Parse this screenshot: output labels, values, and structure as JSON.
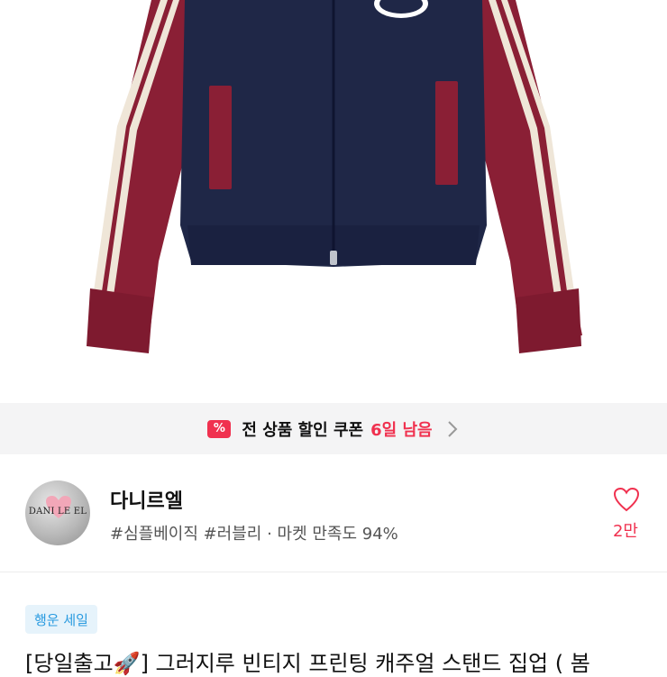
{
  "coupon": {
    "icon": "percent-coupon-icon",
    "icon_glyph": "%",
    "text": "전 상품 할인 쿠폰",
    "days": "6일 남음"
  },
  "shop": {
    "name": "다니르엘",
    "avatar_text": "DANI LE EL",
    "tags": "#심플베이직 #러블리 · 마켓 만족도 94%",
    "like_count": "2만"
  },
  "product": {
    "badge": "행운 세일",
    "title": "[당일출고🚀] 그러지루 빈티지 프린팅 캐주얼 스탠드 집업 ( 봄"
  },
  "colors": {
    "accent": "#f0314f",
    "navy": "#1f2747",
    "burgundy": "#8a1f35",
    "badge_bg": "#e6f3fb",
    "badge_text": "#2a9be0"
  }
}
